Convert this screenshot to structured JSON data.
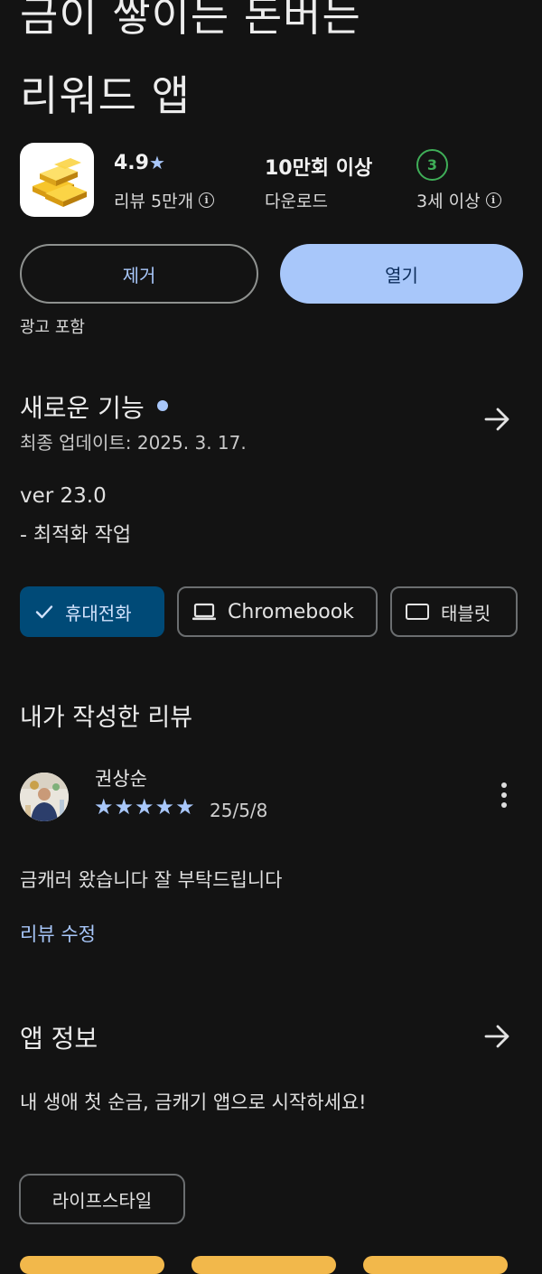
{
  "app": {
    "title_line1": "금이 쌓이는 돈버는",
    "title_line2": "리워드 앱"
  },
  "stats": {
    "rating": "4.9",
    "rating_star": "★",
    "reviews_label": "리뷰 5만개",
    "downloads": "10만회 이상",
    "downloads_label": "다운로드",
    "age_rating": "3",
    "age_label": "3세 이상"
  },
  "actions": {
    "uninstall_label": "제거",
    "open_label": "열기",
    "ads_notice": "광고 포함"
  },
  "whats_new": {
    "heading": "새로운 기능",
    "last_updated": "최종 업데이트: 2025. 3. 17.",
    "version": "ver 23.0",
    "note": "- 최적화 작업"
  },
  "device_chips": [
    {
      "label": "휴대전화",
      "selected": true,
      "icon": "check-icon"
    },
    {
      "label": "Chromebook",
      "selected": false,
      "icon": "laptop-icon"
    },
    {
      "label": "태블릿",
      "selected": false,
      "icon": "tablet-icon"
    }
  ],
  "my_review": {
    "heading": "내가 작성한 리뷰",
    "reviewer": "권상순",
    "stars": 5,
    "date": "25/5/8",
    "text": "금캐러 왔습니다 잘 부탁드립니다",
    "edit_label": "리뷰 수정"
  },
  "about": {
    "heading": "앱 정보",
    "description": "내 생애 첫 순금, 금캐기 앱으로 시작하세요!",
    "category": "라이프스타일"
  },
  "colors": {
    "background": "#131313",
    "accent": "#a8c7fa",
    "selected_chip": "#004a77",
    "age_badge": "#3fae58"
  }
}
